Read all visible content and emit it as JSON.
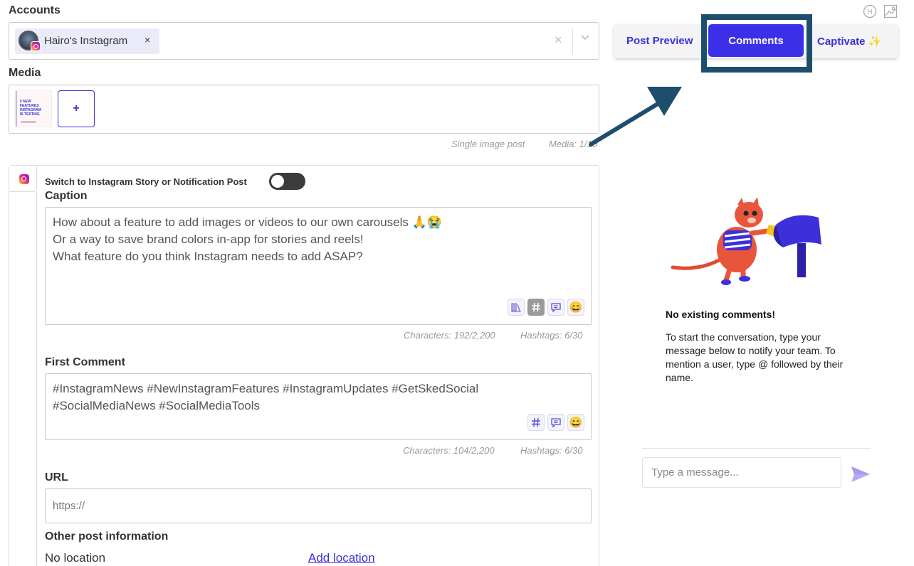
{
  "accounts": {
    "label": "Accounts",
    "selected": [
      {
        "name": "Hairo's Instagram",
        "remove": "×"
      }
    ],
    "clear": "×"
  },
  "media": {
    "label": "Media",
    "add_label": "+",
    "post_type": "Single image post",
    "count": "Media: 1/10",
    "thumbnail_text": [
      "5 NEW",
      "FEATURES",
      "INSTAGRAM",
      "IS TESTING"
    ]
  },
  "post": {
    "switch_label": "Switch to Instagram Story or Notification Post",
    "caption": {
      "label": "Caption",
      "lines": [
        "How about a feature to add images or videos to our own carousels 🙏😭",
        "",
        "Or a way to save brand colors in-app for stories and reels!",
        "",
        "What feature do you think Instagram needs to add ASAP?"
      ],
      "characters": "Characters: 192/2,200",
      "hashtags": "Hashtags: 6/30"
    },
    "first_comment": {
      "label": "First Comment",
      "lines": [
        "#InstagramNews #NewInstagramFeatures #InstagramUpdates #GetSkedSocial",
        "#SocialMediaNews #SocialMediaTools"
      ],
      "characters": "Characters: 104/2,200",
      "hashtags": "Hashtags: 6/30"
    },
    "url": {
      "label": "URL",
      "placeholder": "https://"
    },
    "other_info": {
      "label": "Other post information",
      "location": "No location",
      "add_location": "Add location"
    },
    "emoji": "😄"
  },
  "right_panel": {
    "top_icons": [
      "help-circle-icon",
      "image-broken-icon"
    ],
    "tabs": {
      "preview": "Post Preview",
      "comments": "Comments",
      "captivate": "Captivate ✨"
    },
    "active_tab": "comments",
    "empty_title": "No existing comments!",
    "empty_body": "To start the conversation, type your message below to notify your team. To mention a user, type @ followed by their name.",
    "message_placeholder": "Type a message...",
    "top_icon_letter": "H"
  },
  "colors": {
    "accent": "#3b30e8",
    "annotation": "#1e4e6e",
    "border": "#c9c9c9"
  }
}
